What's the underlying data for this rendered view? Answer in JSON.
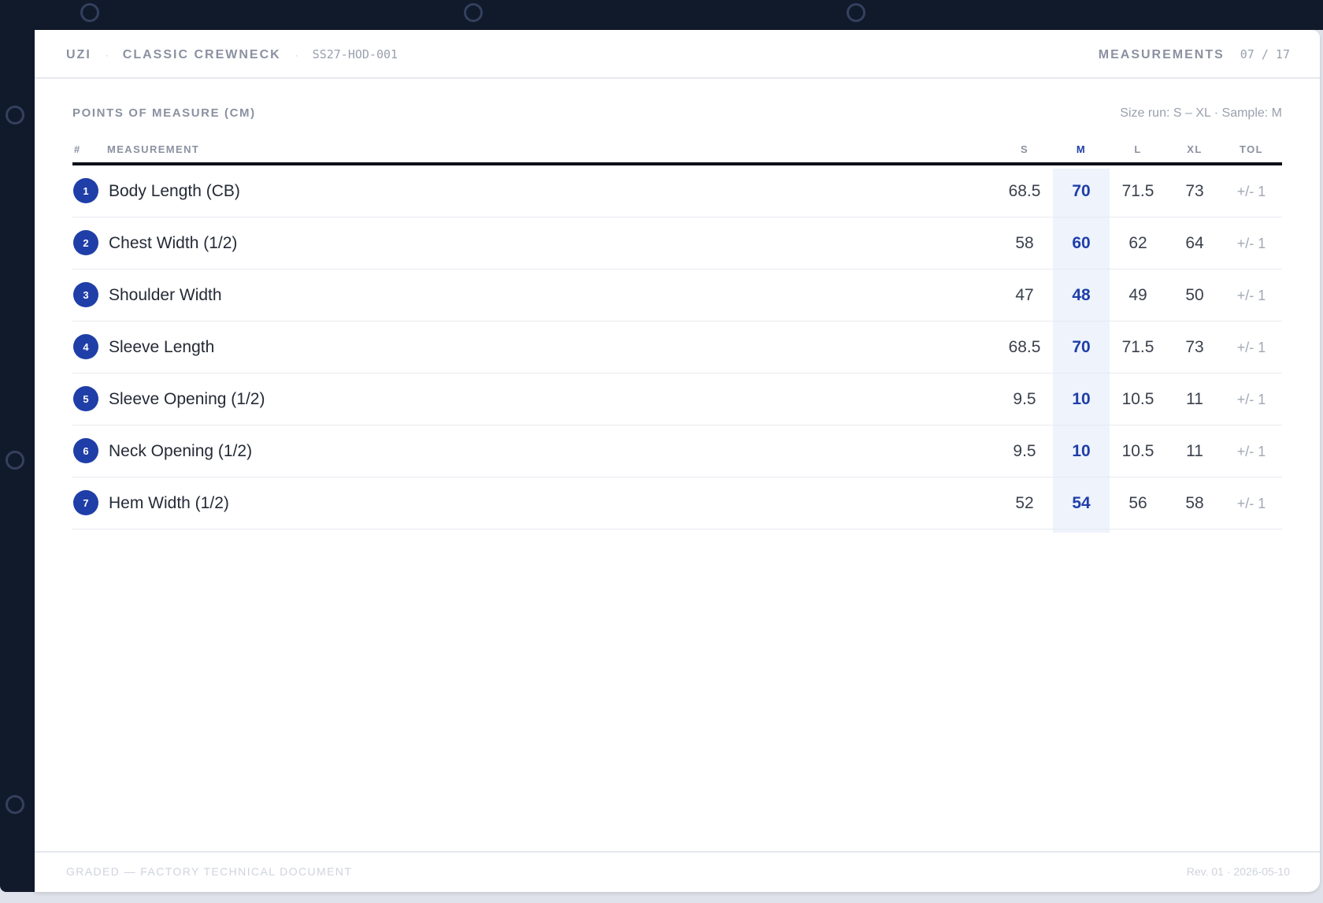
{
  "header": {
    "brand": "UZI",
    "separator": "·",
    "model": "CLASSIC CREWNECK",
    "style_code": "SS27-HOD-001",
    "section": "MEASUREMENTS",
    "page": "07 / 17"
  },
  "pom": {
    "title": "POINTS OF MEASURE (CM)",
    "size_run": "Size run: S – XL · Sample: M"
  },
  "table": {
    "columns": {
      "num": "#",
      "measurement": "MEASUREMENT",
      "s": "S",
      "m": "M",
      "l": "L",
      "xl": "XL",
      "tol": "TOL"
    },
    "rows": [
      {
        "n": "1",
        "name": "Body Length (CB)",
        "s": "68.5",
        "m": "70",
        "l": "71.5",
        "xl": "73",
        "tol": "+/- 1"
      },
      {
        "n": "2",
        "name": "Chest Width (1/2)",
        "s": "58",
        "m": "60",
        "l": "62",
        "xl": "64",
        "tol": "+/- 1"
      },
      {
        "n": "3",
        "name": "Shoulder Width",
        "s": "47",
        "m": "48",
        "l": "49",
        "xl": "50",
        "tol": "+/- 1"
      },
      {
        "n": "4",
        "name": "Sleeve Length",
        "s": "68.5",
        "m": "70",
        "l": "71.5",
        "xl": "73",
        "tol": "+/- 1"
      },
      {
        "n": "5",
        "name": "Sleeve Opening (1/2)",
        "s": "9.5",
        "m": "10",
        "l": "10.5",
        "xl": "11",
        "tol": "+/- 1"
      },
      {
        "n": "6",
        "name": "Neck Opening (1/2)",
        "s": "9.5",
        "m": "10",
        "l": "10.5",
        "xl": "11",
        "tol": "+/- 1"
      },
      {
        "n": "7",
        "name": "Hem Width (1/2)",
        "s": "52",
        "m": "54",
        "l": "56",
        "xl": "58",
        "tol": "+/- 1"
      }
    ]
  },
  "footer": {
    "left": "GRADED — FACTORY TECHNICAL DOCUMENT",
    "right": "Rev. 01 · 2026-05-10"
  },
  "colors": {
    "binder": "#111a2b",
    "accent": "#1f3ea8",
    "sample_column": "#eef3fc"
  }
}
